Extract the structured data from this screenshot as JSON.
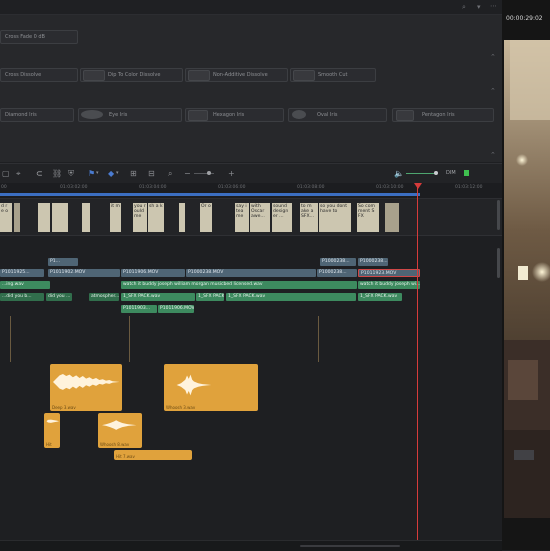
{
  "effects": {
    "cross_fade": "Cross Fade 0 dB",
    "row1": [
      "Cross Dissolve",
      "Dip To Color Dissolve",
      "Non-Additive Dissolve",
      "Smooth Cut"
    ],
    "row2": [
      "Diamond Iris",
      "Eye Iris",
      "Hexagon Iris",
      "Oval Iris",
      "Pentagon Iris"
    ]
  },
  "timecodes": [
    "00",
    "01:03:02:00",
    "01:03:04:00",
    "01:03:06:00",
    "01:03:08:00",
    "01:03:10:00",
    "01:03:12:00",
    "01:03:14:00"
  ],
  "toolbar": {
    "audio_label": "DIM"
  },
  "viewer": {
    "timecode": "00:00:29:02"
  },
  "video_thumbs": [
    "d r e o",
    "",
    "",
    "it m",
    "you r ould me",
    "sh a k",
    "Or o",
    "say i tea me",
    "with Oscar awe...",
    "sound design er ...",
    "to m ake a SFX...",
    "so you dont have to",
    "So com ment S FX"
  ],
  "v2_clips": [
    "P1...",
    "P1000238...",
    "P1000238..."
  ],
  "v1_clips": [
    "P1011925...",
    "P1011902.MOV",
    "P1011906.MOV",
    "P1000238.MOV",
    "P1000238...",
    "P1011923.MOV"
  ],
  "a1_clips": [
    "...ing.wav",
    "watch it buddy joseph william morgan musicbed licensed.wav",
    "watch it buddy joseph wi..."
  ],
  "a2_clips": [
    "...did you b...",
    "did you ...",
    "atmospher...",
    "1_SFX PACK.wav",
    "1_SFX PACK.wav",
    "1_SFX PACK.wav",
    "1_SFX PACK.wav"
  ],
  "a3_clips": [
    "P1011903...",
    "P1011906.MOV"
  ],
  "orange_clips": [
    "Deep 3.wav",
    "Whoosh 3.wav",
    "Hit",
    "Whoosh 8.wav",
    "Hit 7.wav"
  ],
  "colors": {
    "accent_playhead": "#d63b3b",
    "video_clip": "#4f6575",
    "audio_clip": "#3d8a5f",
    "sfx_clip": "#e0a23c"
  }
}
